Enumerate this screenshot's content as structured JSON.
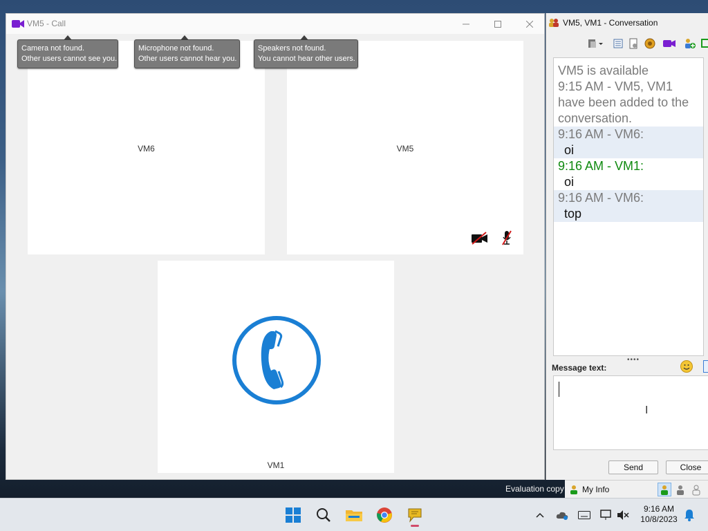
{
  "call_window": {
    "title": "VM5 - Call",
    "tiles": {
      "vm6": "VM6",
      "vm5": "VM5",
      "vm1": "VM1"
    },
    "tooltips": [
      {
        "line1": "Camera not found.",
        "line2": "Other users cannot see you."
      },
      {
        "line1": "Microphone not found.",
        "line2": "Other users cannot hear you."
      },
      {
        "line1": "Speakers not found.",
        "line2": "You cannot hear other users."
      }
    ]
  },
  "conversation": {
    "title": "VM5, VM1 - Conversation",
    "messages": [
      "VM5 is available",
      "9:15 AM - VM5, VM1 have been added to the conversation.",
      "9:16 AM - VM6:",
      "oi",
      "9:16 AM - VM1:",
      "oi",
      "9:16 AM - VM6:",
      "top"
    ],
    "message_label": "Message text:",
    "send_label": "Send",
    "close_label": "Close"
  },
  "status": {
    "evaluation": "Evaluation copy",
    "my_info": "My Info"
  },
  "taskbar": {
    "time": "9:16 AM",
    "date": "10/8/2023"
  },
  "colors": {
    "accent_blue": "#1a7fd4",
    "green_sender": "#108a10",
    "shaded_row": "#e6edf6",
    "camera_purple": "#7a1fd1"
  }
}
